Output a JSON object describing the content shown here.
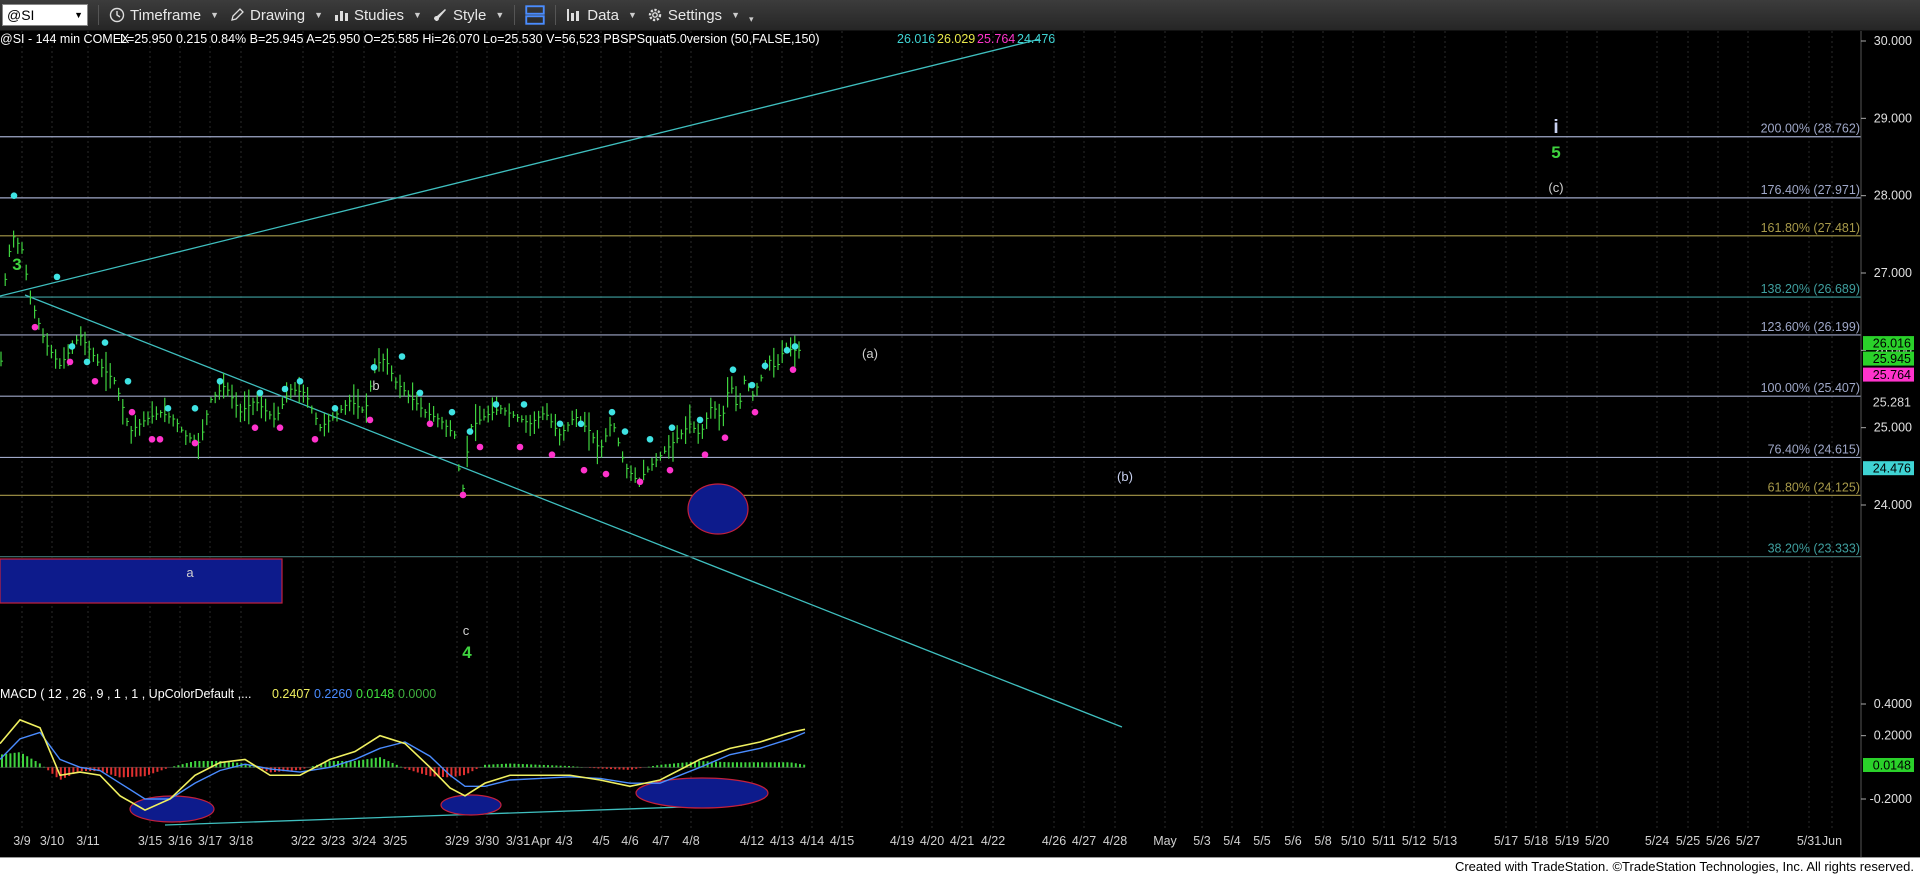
{
  "toolbar": {
    "symbol": "@SI",
    "timeframe": "Timeframe",
    "drawing": "Drawing",
    "studies": "Studies",
    "style": "Style",
    "data": "Data",
    "settings": "Settings"
  },
  "status_line": {
    "symbol_info": "@SI - 144 min  COMEX",
    "quote": "L=25.950  0.215  0.84%  B=25.945  A=25.950  O=25.585  Hi=26.070  Lo=25.530  V=56,523  PBSPSquat5.0version (50,FALSE,150)",
    "values": [
      {
        "text": "26.016",
        "color": "#3fd3d3"
      },
      {
        "text": "26.029",
        "color": "#e8e84a"
      },
      {
        "text": "25.764",
        "color": "#ff33cc"
      },
      {
        "text": "24.476",
        "color": "#3fd3d3"
      }
    ]
  },
  "macd_line": {
    "label": "MACD ( 12 , 26 , 9 , 1 , 1 , UpColorDefault ,...",
    "values": [
      {
        "text": "0.2407",
        "color": "#f0f060"
      },
      {
        "text": "0.2260",
        "color": "#4a8cff"
      },
      {
        "text": "0.0148",
        "color": "#3fe03f"
      },
      {
        "text": "0.0000",
        "color": "#3fb03f"
      }
    ]
  },
  "chart_data": {
    "type": "bar",
    "price_axis_ticks": [
      "30.000",
      "29.000",
      "28.000",
      "27.000",
      "26.000",
      "25.000",
      "24.000"
    ],
    "price_ylim": [
      23.2,
      30.15
    ],
    "macd_axis_ticks": [
      "0.4000",
      "0.2000",
      "-0.2000"
    ],
    "price_markers": [
      {
        "text": "26.016",
        "price": 26.016,
        "bg": "#2ad12a",
        "fg": "#000000"
      },
      {
        "text": "25.945",
        "price": 25.945,
        "bg": "#2ad12a",
        "fg": "#000000"
      },
      {
        "text": "25.764",
        "price": 25.764,
        "bg": "#ff33cc",
        "fg": "#000000"
      },
      {
        "text": "25.281",
        "price": 25.281,
        "bg": "#000000",
        "fg": "#d8d8d8"
      },
      {
        "text": "24.476",
        "price": 24.476,
        "bg": "#3fd3d3",
        "fg": "#000000"
      }
    ],
    "macd_marker": {
      "text": "0.0148",
      "bg": "#2ad12a",
      "fg": "#000000"
    },
    "x_labels": [
      "3/9",
      "3/10",
      "3/11",
      "3/15",
      "3/16",
      "3/17",
      "3/18",
      "3/22",
      "3/23",
      "3/24",
      "3/25",
      "3/29",
      "3/30",
      "3/31",
      "Apr",
      "4/3",
      "4/5",
      "4/6",
      "4/7",
      "4/8",
      "4/12",
      "4/13",
      "4/14",
      "4/15",
      "4/19",
      "4/20",
      "4/21",
      "4/22",
      "4/26",
      "4/27",
      "4/28",
      "May",
      "5/3",
      "5/4",
      "5/5",
      "5/6",
      "5/8",
      "5/10",
      "5/11",
      "5/12",
      "5/13",
      "5/17",
      "5/18",
      "5/19",
      "5/20",
      "5/24",
      "5/25",
      "5/26",
      "5/27",
      "5/31",
      "Jun"
    ],
    "fib_levels": [
      {
        "label": "200.00% (28.762)",
        "price": 28.762,
        "color": "#9fa8c8"
      },
      {
        "label": "176.40% (27.971)",
        "price": 27.971,
        "color": "#9fa8c8"
      },
      {
        "label": "161.80% (27.481)",
        "price": 27.481,
        "color": "#a89a4a"
      },
      {
        "label": "138.20% (26.689)",
        "price": 26.689,
        "color": "#3f9f9f"
      },
      {
        "label": "123.60% (26.199)",
        "price": 26.199,
        "color": "#9fa8c8"
      },
      {
        "label": "100.00% (25.407)",
        "price": 25.407,
        "color": "#9fa8c8"
      },
      {
        "label": "76.40% (24.615)",
        "price": 24.615,
        "color": "#9fa8c8"
      },
      {
        "label": "61.80% (24.125)",
        "price": 24.125,
        "color": "#a89a4a"
      },
      {
        "label": "38.20% (23.333)",
        "price": 23.333,
        "color": "#3f9f9f"
      }
    ],
    "annotations": [
      {
        "text": "3",
        "color": "#3fd33f",
        "bold": true
      },
      {
        "text": "b",
        "color": "#d0d0d0",
        "bold": false
      },
      {
        "text": "a",
        "color": "#d0d0d0",
        "bold": false
      },
      {
        "text": "c",
        "color": "#d0d0d0",
        "bold": false
      },
      {
        "text": "4",
        "color": "#3fd33f",
        "bold": true
      },
      {
        "text": "(a)",
        "color": "#d0d0d0",
        "bold": false
      },
      {
        "text": "(b)",
        "color": "#c8d0f0",
        "bold": false
      },
      {
        "text": "i",
        "color": "#c8d0f0",
        "bold": true
      },
      {
        "text": "5",
        "color": "#3fd33f",
        "bold": true
      },
      {
        "text": "(c)",
        "color": "#d0d0d0",
        "bold": false
      }
    ],
    "price_path": [
      [
        0,
        25.6
      ],
      [
        5,
        26.9
      ],
      [
        12,
        27.5
      ],
      [
        22,
        27.3
      ],
      [
        30,
        26.7
      ],
      [
        45,
        26.1
      ],
      [
        60,
        25.8
      ],
      [
        80,
        26.2
      ],
      [
        100,
        25.8
      ],
      [
        115,
        25.6
      ],
      [
        130,
        24.95
      ],
      [
        145,
        25.1
      ],
      [
        160,
        25.2
      ],
      [
        175,
        25.1
      ],
      [
        185,
        24.9
      ],
      [
        200,
        24.8
      ],
      [
        210,
        25.35
      ],
      [
        225,
        25.55
      ],
      [
        240,
        25.2
      ],
      [
        255,
        25.35
      ],
      [
        275,
        25.1
      ],
      [
        290,
        25.5
      ],
      [
        305,
        25.45
      ],
      [
        320,
        25.0
      ],
      [
        335,
        25.15
      ],
      [
        350,
        25.35
      ],
      [
        365,
        25.2
      ],
      [
        375,
        25.8
      ],
      [
        385,
        25.9
      ],
      [
        395,
        25.6
      ],
      [
        410,
        25.4
      ],
      [
        425,
        25.2
      ],
      [
        440,
        25.1
      ],
      [
        455,
        24.9
      ],
      [
        462,
        24.1
      ],
      [
        470,
        25.0
      ],
      [
        485,
        25.15
      ],
      [
        500,
        25.25
      ],
      [
        515,
        25.15
      ],
      [
        530,
        25.05
      ],
      [
        545,
        25.2
      ],
      [
        560,
        24.9
      ],
      [
        575,
        25.15
      ],
      [
        590,
        24.95
      ],
      [
        600,
        24.7
      ],
      [
        612,
        25.1
      ],
      [
        625,
        24.5
      ],
      [
        638,
        24.3
      ],
      [
        650,
        24.5
      ],
      [
        665,
        24.7
      ],
      [
        680,
        24.9
      ],
      [
        690,
        25.05
      ],
      [
        700,
        24.9
      ],
      [
        712,
        25.3
      ],
      [
        722,
        25.1
      ],
      [
        730,
        25.6
      ],
      [
        738,
        25.2
      ],
      [
        745,
        25.65
      ],
      [
        752,
        25.4
      ],
      [
        760,
        25.6
      ],
      [
        768,
        25.9
      ],
      [
        776,
        25.75
      ],
      [
        785,
        26.05
      ],
      [
        792,
        26.0
      ],
      [
        800,
        26.0
      ]
    ],
    "macd_path": [
      [
        0,
        0.15
      ],
      [
        20,
        0.3
      ],
      [
        40,
        0.25
      ],
      [
        60,
        -0.05
      ],
      [
        80,
        -0.03
      ],
      [
        100,
        -0.05
      ],
      [
        120,
        -0.18
      ],
      [
        145,
        -0.27
      ],
      [
        170,
        -0.2
      ],
      [
        195,
        -0.05
      ],
      [
        220,
        0.03
      ],
      [
        245,
        0.05
      ],
      [
        270,
        -0.05
      ],
      [
        300,
        -0.05
      ],
      [
        330,
        0.05
      ],
      [
        355,
        0.1
      ],
      [
        380,
        0.2
      ],
      [
        405,
        0.15
      ],
      [
        430,
        0.0
      ],
      [
        450,
        -0.13
      ],
      [
        465,
        -0.18
      ],
      [
        485,
        -0.1
      ],
      [
        510,
        -0.05
      ],
      [
        540,
        -0.05
      ],
      [
        570,
        -0.05
      ],
      [
        600,
        -0.08
      ],
      [
        630,
        -0.12
      ],
      [
        660,
        -0.08
      ],
      [
        700,
        0.05
      ],
      [
        730,
        0.12
      ],
      [
        760,
        0.16
      ],
      [
        790,
        0.22
      ],
      [
        805,
        0.24
      ]
    ],
    "signal_path": [
      [
        0,
        0.05
      ],
      [
        20,
        0.18
      ],
      [
        40,
        0.22
      ],
      [
        60,
        0.05
      ],
      [
        80,
        0.0
      ],
      [
        100,
        -0.02
      ],
      [
        120,
        -0.1
      ],
      [
        145,
        -0.2
      ],
      [
        170,
        -0.2
      ],
      [
        195,
        -0.1
      ],
      [
        220,
        -0.02
      ],
      [
        245,
        0.02
      ],
      [
        270,
        -0.01
      ],
      [
        300,
        -0.03
      ],
      [
        330,
        0.0
      ],
      [
        355,
        0.05
      ],
      [
        380,
        0.12
      ],
      [
        405,
        0.16
      ],
      [
        430,
        0.07
      ],
      [
        450,
        -0.05
      ],
      [
        465,
        -0.12
      ],
      [
        485,
        -0.12
      ],
      [
        510,
        -0.08
      ],
      [
        540,
        -0.07
      ],
      [
        570,
        -0.06
      ],
      [
        600,
        -0.07
      ],
      [
        630,
        -0.1
      ],
      [
        660,
        -0.1
      ],
      [
        700,
        0.0
      ],
      [
        730,
        0.08
      ],
      [
        760,
        0.12
      ],
      [
        790,
        0.18
      ],
      [
        805,
        0.22
      ]
    ]
  }
}
